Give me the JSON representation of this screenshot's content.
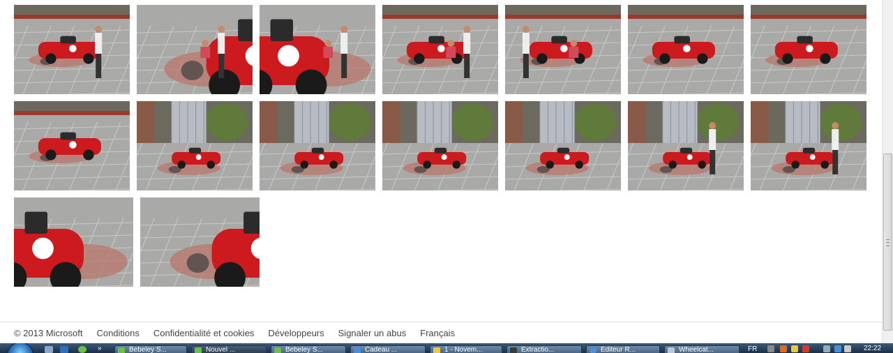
{
  "colors": {
    "car_red": "#cc1a1f",
    "pavement": "#a9aaa8",
    "footer_text": "#444444",
    "taskbar": "#1b2f45"
  },
  "gallery": {
    "rows": [
      {
        "thumbs": [
          {
            "scene": "car-left-child-bike"
          },
          {
            "scene": "people-drawing-chalk"
          },
          {
            "scene": "car-closeup-girl-red-dress"
          },
          {
            "scene": "car-center-man-kneeling"
          },
          {
            "scene": "girl-and-boy-by-car"
          },
          {
            "scene": "car-center-chalk-art"
          },
          {
            "scene": "car-center-chalk-art-2"
          }
        ]
      },
      {
        "thumbs": [
          {
            "scene": "car-left-square"
          },
          {
            "scene": "car-far-centre-pompidou"
          },
          {
            "scene": "car-far-centre-pompidou-2"
          },
          {
            "scene": "car-far-centre-pompidou-3"
          },
          {
            "scene": "car-far-centre-pompidou-4"
          },
          {
            "scene": "car-far-crowd"
          },
          {
            "scene": "car-far-crowd-2"
          }
        ]
      },
      {
        "thumbs": [
          {
            "scene": "car-front-closeup-13"
          },
          {
            "scene": "car-wheel-chalk-closeup"
          }
        ]
      }
    ]
  },
  "footer": {
    "copyright": "© 2013 Microsoft",
    "links": [
      "Conditions",
      "Confidentialité et cookies",
      "Développeurs",
      "Signaler un abus",
      "Français"
    ]
  },
  "taskbar": {
    "buttons": [
      "Bebeley S...",
      "Nouvel ...",
      "Bebeley S...",
      "Cadeau ...",
      "1 - Novem...",
      "Extractio...",
      "Editeur R...",
      "Wheelcat..."
    ],
    "language": "FR",
    "clock": "22:22"
  }
}
